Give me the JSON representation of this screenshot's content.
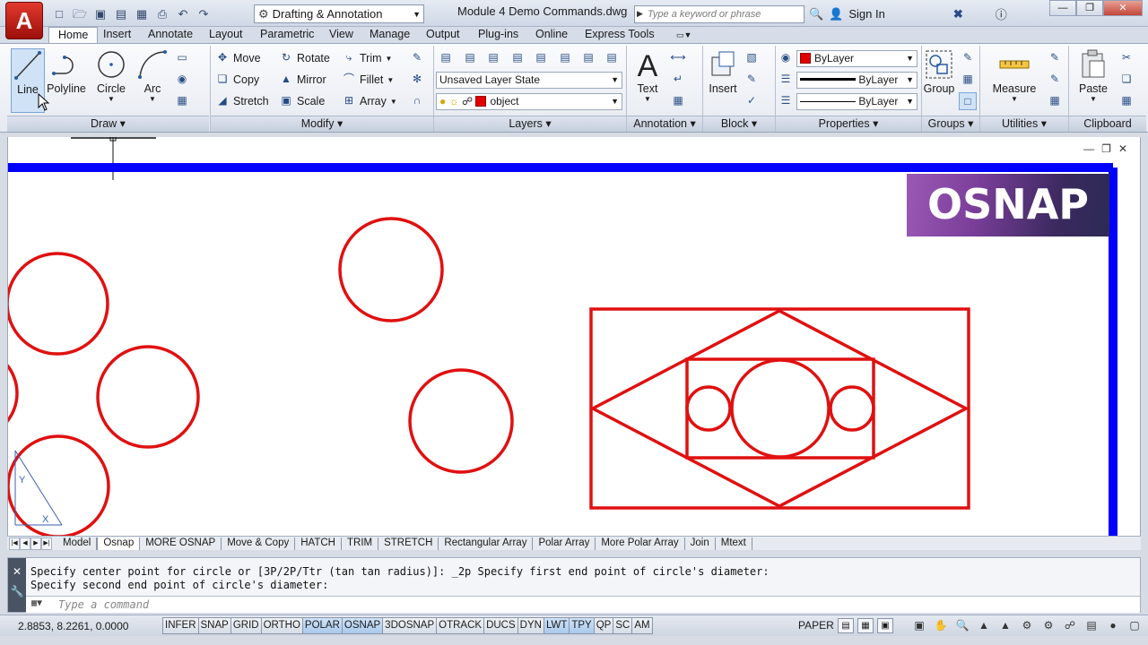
{
  "app": {
    "logo": "A",
    "workspace": "Drafting & Annotation",
    "document_title": "Module 4 Demo Commands.dwg",
    "search_placeholder": "Type a keyword or phrase",
    "sign_in": "Sign In"
  },
  "ribbon_tabs": [
    "Home",
    "Insert",
    "Annotate",
    "Layout",
    "Parametric",
    "View",
    "Manage",
    "Output",
    "Plug-ins",
    "Online",
    "Express Tools"
  ],
  "active_tab": "Home",
  "draw": {
    "title": "Draw",
    "line": "Line",
    "polyline": "Polyline",
    "circle": "Circle",
    "arc": "Arc"
  },
  "modify": {
    "title": "Modify",
    "move": "Move",
    "rotate": "Rotate",
    "trim": "Trim",
    "copy": "Copy",
    "mirror": "Mirror",
    "fillet": "Fillet",
    "stretch": "Stretch",
    "scale": "Scale",
    "array": "Array"
  },
  "layers": {
    "title": "Layers",
    "layer_state": "Unsaved Layer State",
    "current_layer": "object"
  },
  "annotation": {
    "title": "Annotation",
    "text": "Text"
  },
  "block": {
    "title": "Block",
    "insert": "Insert"
  },
  "properties": {
    "title": "Properties",
    "color": "ByLayer",
    "lineweight": "ByLayer",
    "linetype": "ByLayer",
    "layer_color": "#e00000"
  },
  "groups": {
    "title": "Groups",
    "group": "Group"
  },
  "utilities": {
    "title": "Utilities",
    "measure": "Measure"
  },
  "clipboard": {
    "title": "Clipboard",
    "paste": "Paste"
  },
  "overlay": {
    "badge": "OSNAP"
  },
  "layout_tabs": [
    "Model",
    "Osnap",
    "MORE OSNAP",
    "Move & Copy",
    "HATCH",
    "TRIM",
    "STRETCH",
    "Rectangular Array",
    "Polar Array",
    "More Polar Array",
    "Join",
    "Mtext"
  ],
  "active_layout": "Osnap",
  "command": {
    "line1": "Specify center point for circle or [3P/2P/Ttr (tan tan radius)]: _2p Specify first end point of circle's diameter:",
    "line2": "Specify second end point of circle's diameter:",
    "placeholder": "Type a command"
  },
  "status": {
    "coords": "2.8853, 8.2261, 0.0000",
    "toggles": [
      {
        "label": "INFER",
        "on": false
      },
      {
        "label": "SNAP",
        "on": false
      },
      {
        "label": "GRID",
        "on": false
      },
      {
        "label": "ORTHO",
        "on": false
      },
      {
        "label": "POLAR",
        "on": true
      },
      {
        "label": "OSNAP",
        "on": true
      },
      {
        "label": "3DOSNAP",
        "on": false
      },
      {
        "label": "OTRACK",
        "on": false
      },
      {
        "label": "DUCS",
        "on": false
      },
      {
        "label": "DYN",
        "on": false
      },
      {
        "label": "LWT",
        "on": true
      },
      {
        "label": "TPY",
        "on": true
      },
      {
        "label": "QP",
        "on": false
      },
      {
        "label": "SC",
        "on": false
      },
      {
        "label": "AM",
        "on": false
      }
    ],
    "space": "PAPER"
  },
  "colors": {
    "entity": "#e01010",
    "border": "#0000ff",
    "ribbon_bg": "#f3f5f9"
  }
}
